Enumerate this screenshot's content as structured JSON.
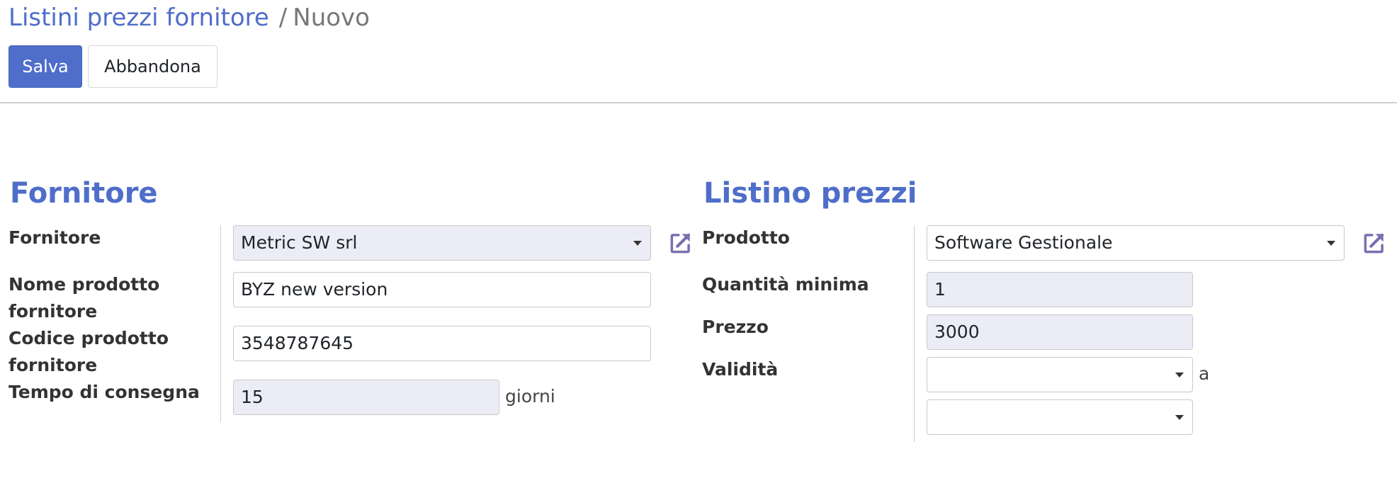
{
  "breadcrumb": {
    "parent": "Listini prezzi fornitore",
    "separator": "/",
    "current": "Nuovo"
  },
  "buttons": {
    "save": "Salva",
    "discard": "Abbandona"
  },
  "colors": {
    "primary": "#4f6ec9",
    "required_field_bg": "#ececf6",
    "border": "#c9c9c9"
  },
  "vendor_section": {
    "title": "Fornitore",
    "vendor": {
      "label": "Fornitore",
      "value": "Metric SW srl",
      "icon": "external-link-icon"
    },
    "product_name": {
      "label_line1": "Nome prodotto",
      "label_line2": "fornitore",
      "value": "BYZ new version"
    },
    "product_code": {
      "label_line1": "Codice prodotto",
      "label_line2": "fornitore",
      "value": "3548787645"
    },
    "delivery_lead": {
      "label": "Tempo di consegna",
      "value": "15",
      "unit": "giorni"
    }
  },
  "pricelist_section": {
    "title": "Listino prezzi",
    "product": {
      "label": "Prodotto",
      "value": "Software Gestionale",
      "icon": "external-link-icon"
    },
    "min_qty": {
      "label": "Quantità minima",
      "value": "1"
    },
    "price": {
      "label": "Prezzo",
      "value": "3000"
    },
    "validity": {
      "label": "Validità",
      "from": "",
      "separator": "a",
      "to": ""
    }
  }
}
